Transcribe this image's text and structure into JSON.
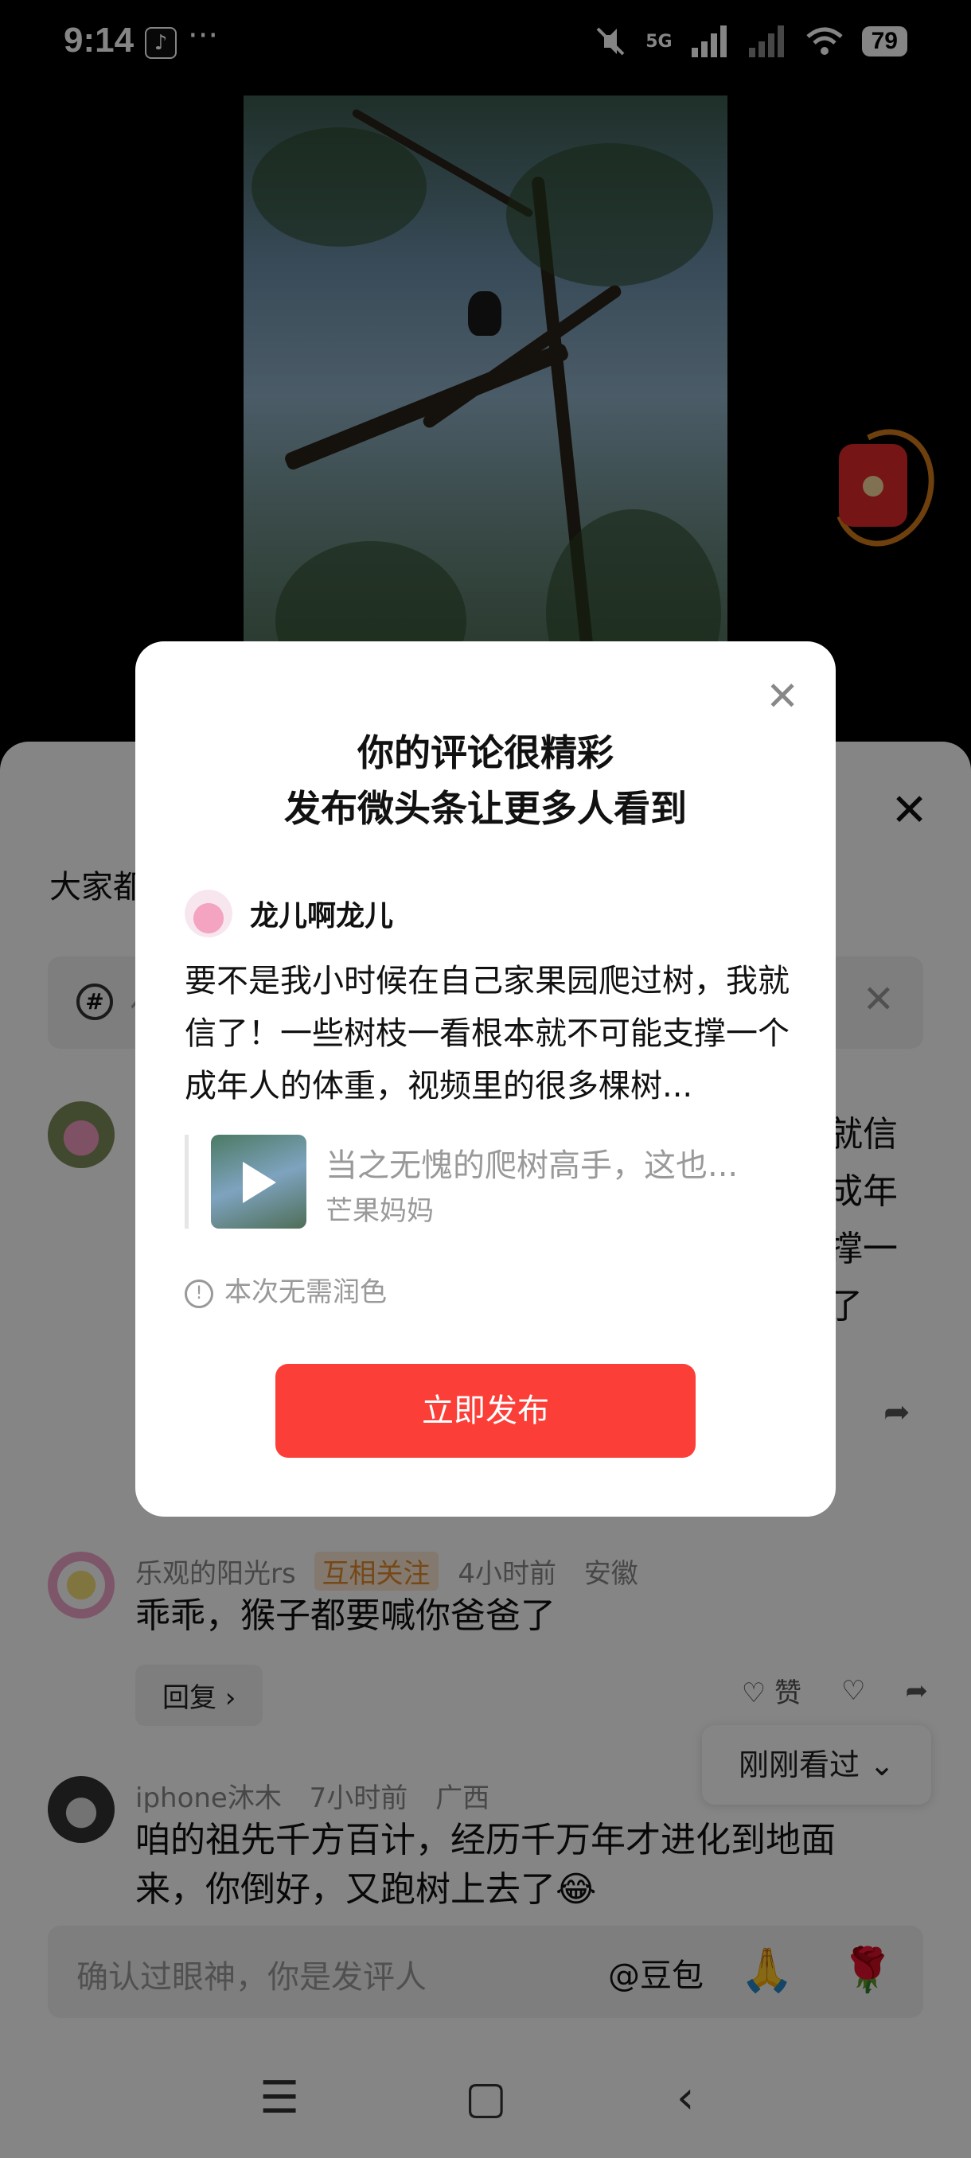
{
  "status_bar": {
    "time": "9:14",
    "more": "···",
    "network": "5G",
    "battery": "79"
  },
  "video": {
    "subject": "monkey in tree"
  },
  "sheet": {
    "topic_text": "大家都",
    "search_placeholder": "你"
  },
  "comments": [
    {
      "partial_lines": [
        "就信",
        "成年",
        "撑一",
        "了"
      ]
    },
    {
      "user": "乐观的阳光rs",
      "tag": "互相关注",
      "time": "4小时前",
      "location": "安徽",
      "text": "乖乖，猴子都要喊你爸爸了",
      "reply_label": "回复 ›",
      "like_label": "赞"
    },
    {
      "user": "iphone沐木",
      "time": "7小时前",
      "location": "广西",
      "text": "咱的祖先千方百计，经历千万年才进化到地面来，你倒好，又跑树上去了😂"
    }
  ],
  "recent": {
    "label": "刚刚看过 ⌄"
  },
  "input_bar": {
    "placeholder": "确认过眼神，你是发评人",
    "at_label": "@豆包",
    "emoji_1": "🙏",
    "emoji_2": "🌹"
  },
  "modal": {
    "title_line1": "你的评论很精彩",
    "title_line2": "发布微头条让更多人看到",
    "author": "龙儿啊龙儿",
    "text": "要不是我小时候在自己家果园爬过树，我就信了！一些树枝一看根本就不可能支撑一个成年人的体重，视频里的很多棵树...",
    "quote_title": "当之无愧的爬树高手，这也...",
    "quote_source": "芒果妈妈",
    "notice": "本次无需润色",
    "publish_label": "立即发布"
  },
  "colors": {
    "accent": "#fc3e38",
    "tag_bg": "#fde8d4",
    "tag_text": "#e08a2f"
  }
}
